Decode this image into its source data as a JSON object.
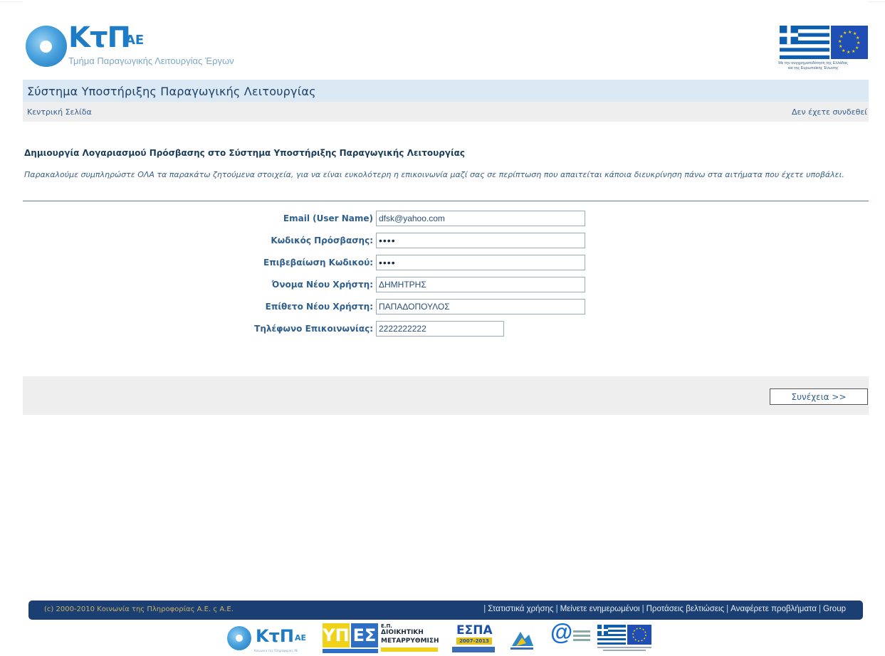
{
  "header": {
    "logo_mark": "ΚτΠ",
    "logo_suffix": "ΑΕ",
    "logo_subtitle": "Τμήμα Παραγωγικής Λειτουργίας Έργων",
    "eu_caption_line1": "Με την συγχρηματοδότηση της Ελλάδας",
    "eu_caption_line2": "και της Ευρωπαϊκής Ένωσης"
  },
  "app": {
    "title": "Σύστημα Υποστήριξης Παραγωγικής Λειτουργίας"
  },
  "nav": {
    "home_link": "Κεντρική Σελίδα",
    "login_status": "Δεν έχετε συνδεθεί"
  },
  "main": {
    "heading": "Δημιουργία Λογαριασμού Πρόσβασης στο Σύστημα Υποστήριξης Παραγωγικής Λειτουργίας",
    "intro": "Παρακαλούμε συμπληρώστε ΟΛΑ τα παρακάτω ζητούμενα στοιχεία, για να είναι ευκολότερη η επικοινωνία μαζί σας σε περίπτωση που απαιτείται κάποια διευκρίνηση πάνω στα αιτήματα που έχετε υποβάλει.",
    "fields": [
      {
        "label": "Email (User Name)",
        "value": "dfsk@yahoo.com"
      },
      {
        "label": "Κωδικός Πρόσβασης:",
        "value": "••••"
      },
      {
        "label": "Επιβεβαίωση Κωδικού:",
        "value": "••••"
      },
      {
        "label": "Όνομα Νέου Χρήστη:",
        "value": "ΔΗΜΗΤΡΗΣ"
      },
      {
        "label": "Επίθετο Νέου Χρήστη:",
        "value": "ΠΑΠΑΔΟΠΟΥΛΟΣ"
      },
      {
        "label": "Τηλέφωνο Επικοινωνίας:",
        "value": "2222222222"
      }
    ],
    "continue_button": "Συνέχεια >>"
  },
  "footer": {
    "copyright": "(c) 2000-2010 Κοινωνία της Πληροφορίας Α.Ε. ς Α.Ε.",
    "links": [
      "Στατιστικά χρήσης",
      "Μείνετε ενημερωμένοι",
      "Προτάσεις βελτιώσεις",
      "Αναφέρετε προβλήματα",
      "Group"
    ],
    "separator": "|"
  },
  "partners": {
    "ktp_mark": "ΚτΠ",
    "ktp_suffix": "ΑΕ",
    "ktp_sub": "Κοινωνία της Πληροφορίας ΑΕ",
    "ypes_1": "ΥΠ",
    "ypes_2": "ΕΣ",
    "ypes_ep": "Ε.Π.",
    "ypes_line1": "ΔΙΟΙΚΗΤΙΚΗ",
    "ypes_line2": "ΜΕΤΑΡΡΥΘΜΙΣΗ",
    "espa": "ΕΣΠΑ",
    "espa_years": "2007-2013",
    "at_sign": "@"
  },
  "colors": {
    "title_bar": "#dbe9f4",
    "nav_bar": "#eeeeee",
    "footer_bar": "#1b3f72",
    "brand_blue": "#1e7cc6"
  }
}
